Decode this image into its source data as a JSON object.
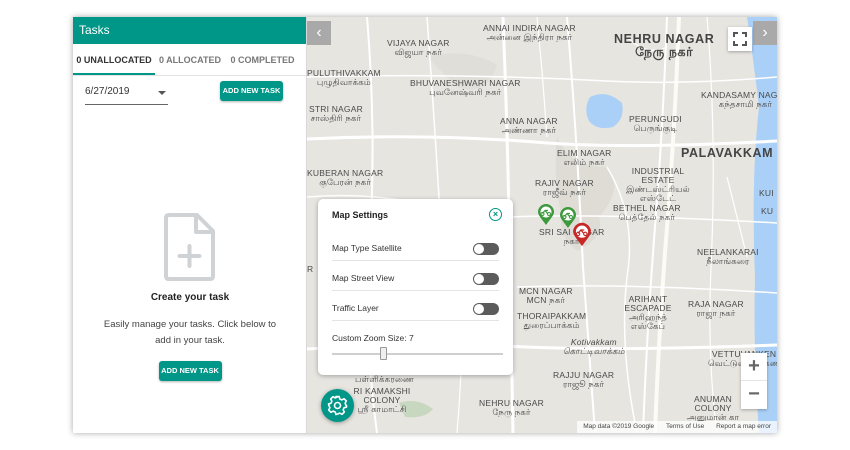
{
  "panel": {
    "title": "Tasks",
    "tabs": [
      {
        "label": "0 UNALLOCATED",
        "active": true
      },
      {
        "label": "0 ALLOCATED",
        "active": false
      },
      {
        "label": "0 COMPLETED",
        "active": false
      }
    ],
    "date_value": "6/27/2019",
    "add_task_label": "ADD NEW TASK",
    "empty_title": "Create your task",
    "empty_text": "Easily manage your tasks. Click below to add in your task.",
    "add_task_bottom_label": "ADD NEW TASK",
    "accent_color": "#009688"
  },
  "map": {
    "nav_left_icon": "chevron-left-icon",
    "nav_right_icon": "chevron-right-icon",
    "fullscreen_icon": "fullscreen-icon",
    "zoom_in_label": "+",
    "zoom_out_label": "−",
    "attribution": {
      "data": "Map data ©2019 Google",
      "terms": "Terms of Use",
      "report": "Report a map error"
    },
    "labels": {
      "annai_indira_nagar": "ANNAI INDIRA NAGAR",
      "annai_indira_nagar_ta": "அன்னை இந்திரா நகர்",
      "vijaya_nagar": "VIJAYA NAGAR",
      "vijaya_nagar_ta": "விஜயா நகர்",
      "nehru_nagar": "NEHRU NAGAR",
      "nehru_nagar_ta": "நேரு நகர்",
      "puluthivakkam": "PULUTHIVAKKAM",
      "puluthivakkam_ta": "புழுதிவாக்கம்",
      "bhuvaneshwari_nagar": "BHUVANESHWARI NAGAR",
      "bhuvaneshwari_nagar_ta": "புவனேஷ்வரி நகர்",
      "kandasamy_nagar": "KANDASAMY NAGAR",
      "kandasamy_nagar_ta": "கந்தசாமி நகர்",
      "perungudi": "PERUNGUDI",
      "perungudi_ta": "பெருங்குடி",
      "stri_nagar": "STRI NAGAR",
      "stri_nagar_ta": "சாஸ்திரி நகர்",
      "anna_nagar": "ANNA NAGAR",
      "anna_nagar_ta": "அண்ணா நகர்",
      "palavakkam": "PALAVAKKAM",
      "elim_nagar": "ELIM NAGAR",
      "elim_nagar_ta": "எலிம் நகர்",
      "industrial_estate": "INDUSTRIAL ESTATE",
      "industrial_estate_ta": "இண்டஸ்ட்ரியல் எஸ்டேட்",
      "kuberan_nagar": "KUBERAN NAGAR",
      "kuberan_nagar_ta": "குபேரன் நகர்",
      "rajiv_nagar": "RAJIV NAGAR",
      "rajiv_nagar_ta": "ராஜீவ் நகர்",
      "bethel_nagar": "BETHEL NAGAR",
      "bethel_nagar_ta": "பெத்தேல் நகர்",
      "sri_sai_nagar": "SRI SAI NAGAR",
      "sri_sai_nagar_ta": "நகர்",
      "neelankarai": "NEELANKARAI",
      "neelankarai_ta": "நீலாங்கரை",
      "mcn_nagar": "MCN NAGAR",
      "mcn_nagar_ta": "MCN நகர்",
      "arihant_escapade": "ARIHANT ESCAPADE",
      "arihant_escapade_ta": "அரிஹந்த் எஸ்கேப்",
      "raja_nagar": "RAJA NAGAR",
      "raja_nagar_ta": "ராஜா நகர்",
      "thoraipakkam": "THORAIPAKKAM",
      "thoraipakkam_ta": "துரைப்பாக்கம்",
      "kotivakkam": "Kotivakkam",
      "kotivakkam_ta": "கொட்டிவாக்கம்",
      "vettuvankeni": "VETTUVANKENI",
      "vettuvankeni_ta": "வெட்டுவாங்கேணி",
      "rajju_nagar": "RAJJU NAGAR",
      "rajju_nagar_ta": "ராஜூ நகர்",
      "pallikaranai_ta": "பள்ளிக்கரணை",
      "kamakshi_colony": "RI KAMAKSHI COLONY",
      "kamakshi_colony_ta": "ஸ்ரீ காமாட்சி",
      "nehru_nagar_south": "NEHRU NAGAR",
      "nehru_nagar_south_ta": "நேரு நகர்",
      "anuman_colony": "ANUMAN COLONY",
      "anuman_colony_ta": "அனுமான் கா",
      "edge_kui": "KUI",
      "edge_r": "R",
      "edge_ku": "KU"
    }
  },
  "settings": {
    "title": "Map Settings",
    "close_icon": "close-circle-icon",
    "rows": [
      {
        "label": "Map Type Satellite",
        "on": false
      },
      {
        "label": "Map Street View",
        "on": false
      },
      {
        "label": "Traffic Layer",
        "on": false
      }
    ],
    "zoom_label": "Custom Zoom Size: 7",
    "zoom_level": 7,
    "gear_icon": "gear-icon"
  },
  "markers": [
    {
      "color": "#3c9a3c",
      "icon": "bike-marker-icon"
    },
    {
      "color": "#3c9a3c",
      "icon": "bike-marker-icon"
    },
    {
      "color": "#c62828",
      "icon": "bike-marker-icon"
    }
  ]
}
